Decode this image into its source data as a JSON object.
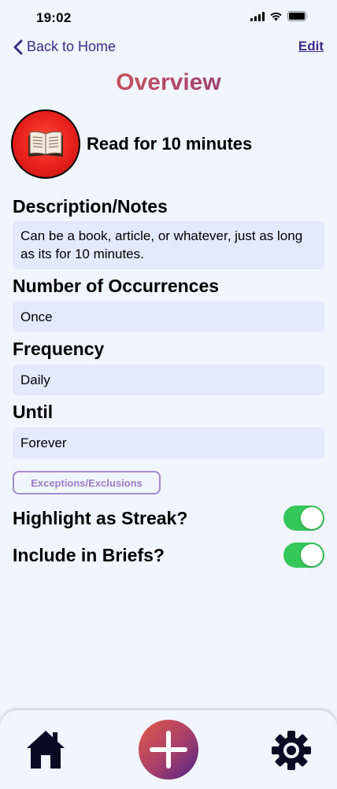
{
  "status_bar": {
    "time": "19:02"
  },
  "nav": {
    "back_label": "Back to Home",
    "edit_label": "Edit"
  },
  "page": {
    "title": "Overview"
  },
  "habit": {
    "name": "Read for 10 minutes",
    "icon": "book-icon",
    "icon_color": "#e8201b"
  },
  "sections": {
    "description": {
      "label": "Description/Notes",
      "value": "Can be a book, article, or whatever, just as long as its for 10 minutes."
    },
    "occurrences": {
      "label": "Number of Occurrences",
      "value": "Once"
    },
    "frequency": {
      "label": "Frequency",
      "value": "Daily"
    },
    "until": {
      "label": "Until",
      "value": "Forever"
    }
  },
  "exceptions": {
    "label": "Exceptions/Exclusions"
  },
  "toggles": {
    "streak": {
      "label": "Highlight as Streak?",
      "on": true
    },
    "briefs": {
      "label": "Include in Briefs?",
      "on": true
    }
  },
  "tab_bar": {
    "home_icon": "home-icon",
    "add_icon": "plus-icon",
    "settings_icon": "gear-icon"
  },
  "colors": {
    "accent": "#3f2a8a",
    "toggle_on": "#34c759",
    "field_bg": "#e4eafd",
    "page_bg": "#f1f5fe"
  }
}
